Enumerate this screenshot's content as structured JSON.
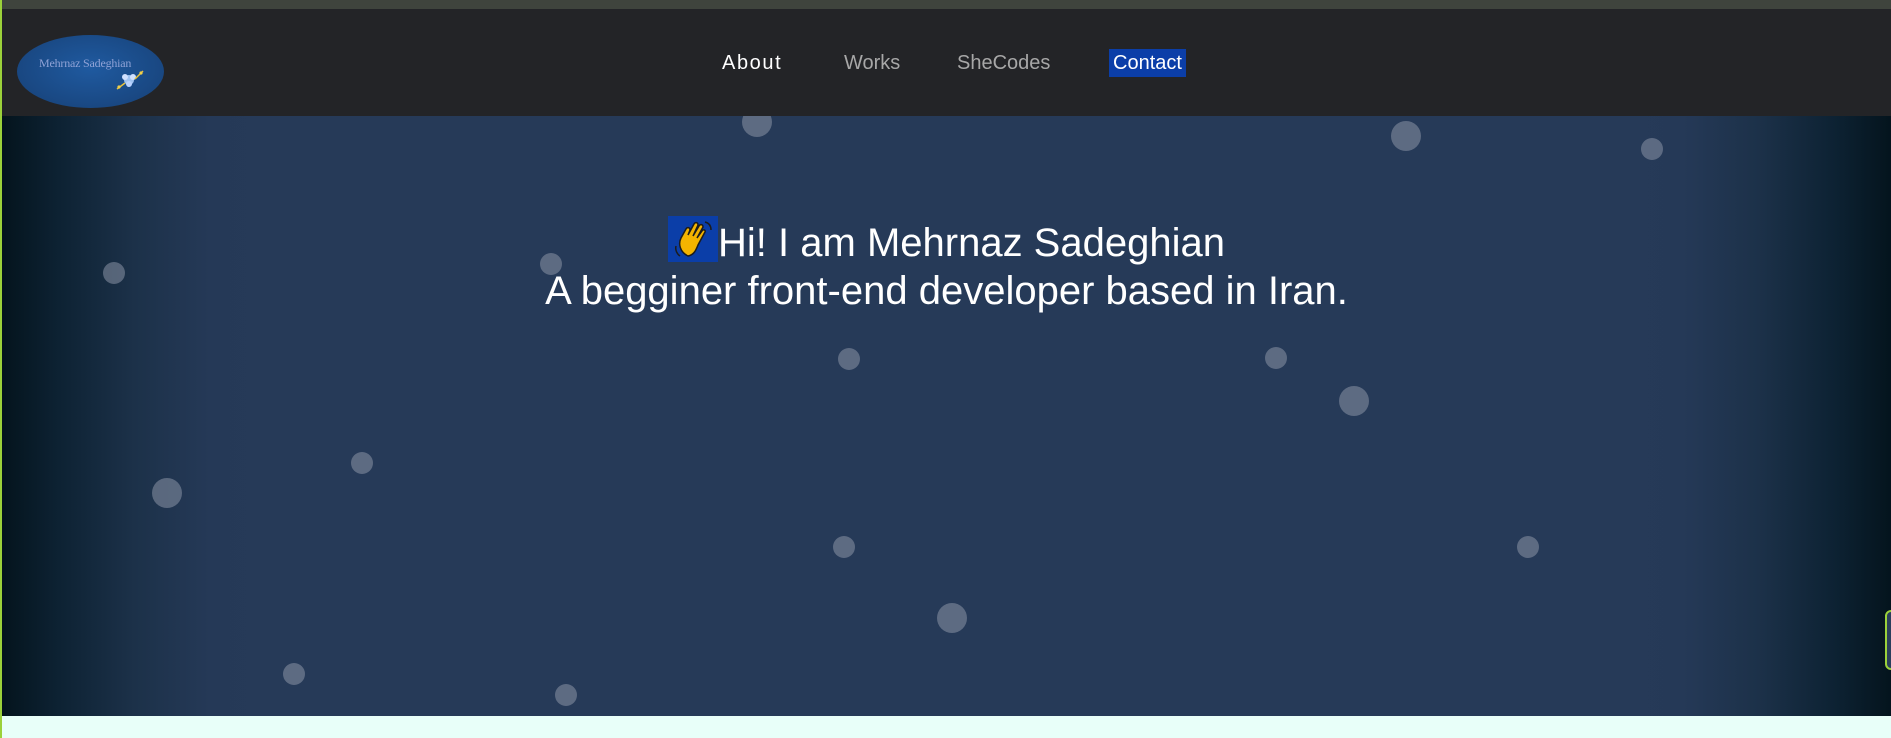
{
  "logo": {
    "text": "Mehrnaz Sadeghian"
  },
  "nav": {
    "items": [
      {
        "label": "About"
      },
      {
        "label": "Works"
      },
      {
        "label": "SheCodes"
      },
      {
        "label": "Contact"
      }
    ]
  },
  "hero": {
    "greeting": "Hi! I am Mehrnaz Sadeghian",
    "tagline": "A begginer front-end developer based in Iran.",
    "wave_icon": "waving-hand-icon"
  },
  "colors": {
    "navbar": "#232427",
    "hero": "#263a58",
    "contact_highlight": "#0b3ea8",
    "page_background": "#e8fff9"
  }
}
